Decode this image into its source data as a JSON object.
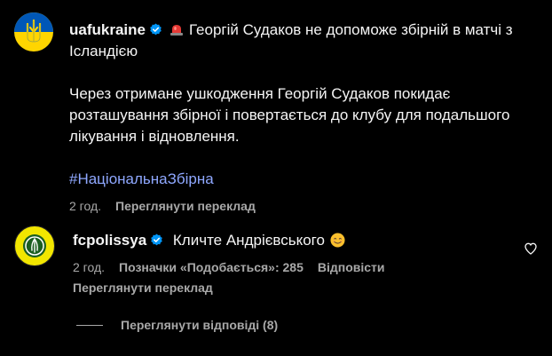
{
  "post": {
    "username": "uafukraine",
    "title": "Георгій Судаков не допоможе збірній в матчі з Ісландією",
    "body": "Через отримане ушкодження Георгій Судаков покидає розташування збірної і повертається до клубу для подальшого лікування і відновлення.",
    "hashtag": "#НаціональнаЗбірна",
    "time": "2 год.",
    "translate_label": "Переглянути переклад"
  },
  "comment": {
    "username": "fcpolissya",
    "text": "Кличте Андрієвського",
    "time": "2 год.",
    "likes_label": "Позначки «Подобається»: 285",
    "reply_label": "Відповісти",
    "translate_label": "Переглянути переклад"
  },
  "replies": {
    "label": "Переглянути відповіді (8)"
  },
  "colors": {
    "background": "#000000",
    "text": "#f5f5f5",
    "secondary": "#a8a8a8",
    "hashtag": "#8fa8ff",
    "verified": "#0095f6"
  },
  "icons": {
    "verified": "verified-badge-icon",
    "siren": "siren-icon",
    "emoji": "smiling-face-emoji-icon",
    "heart": "heart-outline-icon"
  }
}
